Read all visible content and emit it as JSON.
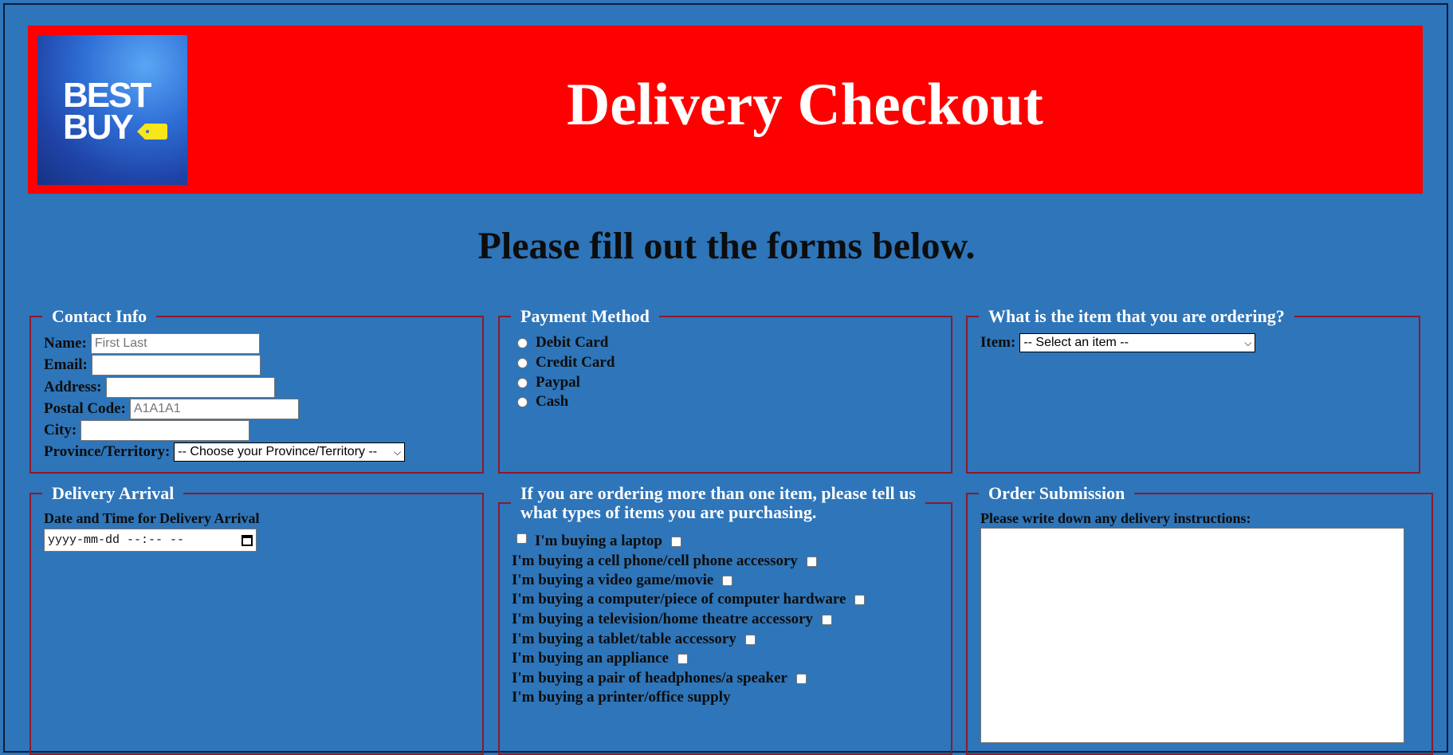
{
  "banner": {
    "logo_text": "BEST BUY",
    "title": "Delivery Checkout",
    "background_color": "#ff0000"
  },
  "subheading": "Please fill out the forms below.",
  "contact": {
    "legend": "Contact Info",
    "name_label": "Name:",
    "name_placeholder": "First Last",
    "email_label": "Email:",
    "address_label": "Address:",
    "postal_label": "Postal Code:",
    "postal_placeholder": "A1A1A1",
    "city_label": "City:",
    "province_label": "Province/Territory:",
    "province_selected": "-- Choose your Province/Territory --"
  },
  "payment": {
    "legend": "Payment Method",
    "options": [
      "Debit Card",
      "Credit Card",
      "Paypal",
      "Cash"
    ]
  },
  "item": {
    "legend": "What is the item that you are ordering?",
    "label": "Item:",
    "selected": "-- Select an item --"
  },
  "delivery": {
    "legend": "Delivery Arrival",
    "label": "Date and Time for Delivery Arrival",
    "placeholder": "yyyy-mm-dd --:-- --"
  },
  "multi": {
    "legend_line1": "If you are ordering more than one item, please tell us",
    "legend_line2": "what types of items you are purchasing.",
    "options": [
      "I'm buying a laptop",
      "I'm buying a cell phone/cell phone accessory",
      "I'm buying a video game/movie",
      "I'm buying a computer/piece of computer hardware",
      "I'm buying a television/home theatre accessory",
      "I'm buying a tablet/table accessory",
      "I'm buying an appliance",
      "I'm buying a pair of headphones/a speaker",
      "I'm buying a printer/office supply"
    ]
  },
  "order": {
    "legend": "Order Submission",
    "instructions_label": "Please write down any delivery instructions:"
  },
  "colors": {
    "page_background": "#2e75b9",
    "fieldset_border": "#8b1a2b"
  }
}
